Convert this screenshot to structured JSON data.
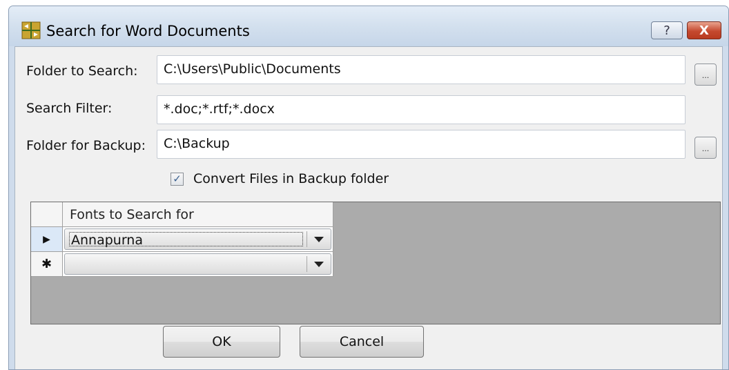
{
  "window": {
    "title": "Search for Word Documents",
    "help_label": "?",
    "close_label": "X"
  },
  "fields": {
    "folder_to_search": {
      "label": "Folder to Search:",
      "value": "C:\\Users\\Public\\Documents",
      "browse_label": "..."
    },
    "search_filter": {
      "label": "Search Filter:",
      "value": "*.doc;*.rtf;*.docx"
    },
    "folder_for_backup": {
      "label": "Folder for Backup:",
      "value": "C:\\Backup",
      "browse_label": "..."
    }
  },
  "convert_checkbox": {
    "label": "Convert Files in Backup folder",
    "checked": true,
    "check_glyph": "✓"
  },
  "fonts_grid": {
    "column_header": "Fonts to Search for",
    "rows": [
      {
        "marker": "▶",
        "value": "Annapurna"
      },
      {
        "marker": "✱",
        "value": ""
      }
    ]
  },
  "buttons": {
    "ok": "OK",
    "cancel": "Cancel"
  },
  "colors": {
    "titlebar": "#d3e0ee",
    "grid_background": "#ababab",
    "close_button": "#c5492f"
  }
}
